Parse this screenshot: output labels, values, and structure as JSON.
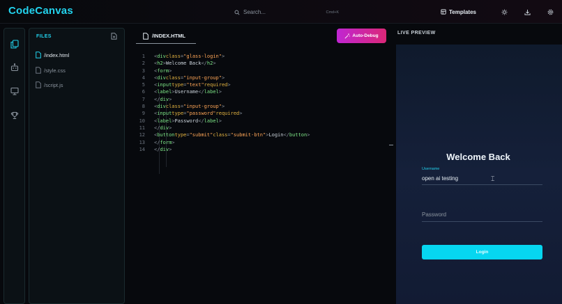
{
  "app": {
    "title": "CodeCanvas"
  },
  "search": {
    "placeholder": "Search...",
    "shortcut": "Cmd+K"
  },
  "toolbar": {
    "templates_label": "Templates"
  },
  "files": {
    "header": "FILES",
    "items": [
      {
        "label": "/index.html"
      },
      {
        "label": "/style.css"
      },
      {
        "label": "/script.js"
      }
    ]
  },
  "editor": {
    "tab_label": "/INDEX.HTML",
    "auto_debug_label": "Auto-Debug"
  },
  "preview": {
    "header": "LIVE PREVIEW",
    "login_title": "Welcome Back",
    "username_label": "Username",
    "username_value": "open ai testing",
    "password_placeholder": "Password",
    "login_button": "Login"
  },
  "colors": {
    "accent": "#22d3ee",
    "debug_gradient_start": "#c026d3",
    "debug_gradient_end": "#db2777",
    "login_button": "#06d6f0"
  }
}
